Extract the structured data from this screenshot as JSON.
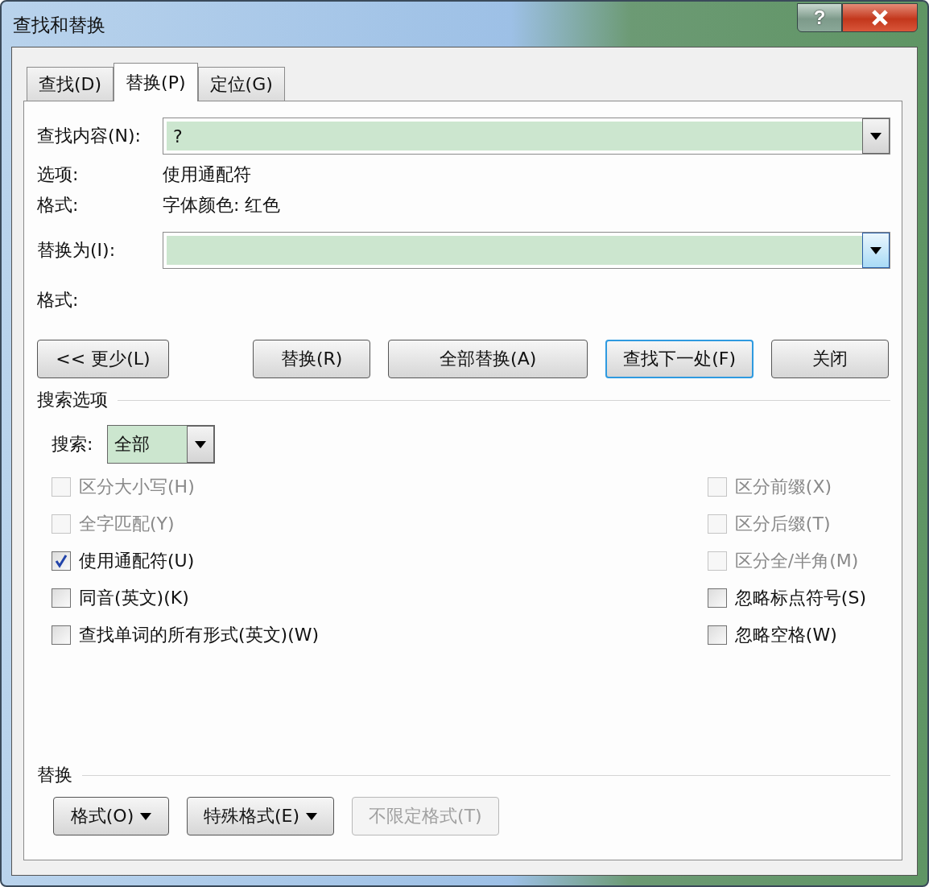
{
  "window": {
    "title": "查找和替换",
    "help": "?"
  },
  "tabs": [
    {
      "label": "查找(D)",
      "selected": false
    },
    {
      "label": "替换(P)",
      "selected": true
    },
    {
      "label": "定位(G)",
      "selected": false
    }
  ],
  "find": {
    "label": "查找内容(N):",
    "value": "?",
    "focused": false
  },
  "options": {
    "label": "选项:",
    "value": "使用通配符"
  },
  "format": {
    "label": "格式:",
    "value": "字体颜色: 红色"
  },
  "replace": {
    "label": "替换为(I):",
    "focused": true
  },
  "replace_format": {
    "label": "格式:"
  },
  "buttons": [
    {
      "label": "<< 更少(L)",
      "default": false
    },
    {
      "label": "替换(R)",
      "default": false
    },
    {
      "label": "全部替换(A)",
      "default": false
    },
    {
      "label": "查找下一处(F)",
      "default": true
    },
    {
      "label": "关闭",
      "default": false
    }
  ],
  "search_options": {
    "title": "搜索选项",
    "search_label": "搜索:",
    "search_value": "全部",
    "left": [
      {
        "label": "区分大小写(H)",
        "checked": false,
        "disabled": true
      },
      {
        "label": "全字匹配(Y)",
        "checked": false,
        "disabled": true
      },
      {
        "label": "使用通配符(U)",
        "checked": true,
        "disabled": false
      },
      {
        "label": "同音(英文)(K)",
        "checked": false,
        "disabled": false
      },
      {
        "label": "查找单词的所有形式(英文)(W)",
        "checked": false,
        "disabled": false
      }
    ],
    "right": [
      {
        "label": "区分前缀(X)",
        "checked": false,
        "disabled": true
      },
      {
        "label": "区分后缀(T)",
        "checked": false,
        "disabled": true
      },
      {
        "label": "区分全/半角(M)",
        "checked": false,
        "disabled": true
      },
      {
        "label": "忽略标点符号(S)",
        "checked": false,
        "disabled": false
      },
      {
        "label": "忽略空格(W)",
        "checked": false,
        "disabled": false
      }
    ]
  },
  "replace_section": {
    "title": "替换",
    "buttons": [
      {
        "label": "格式(O)",
        "dropdown": true,
        "disabled": false
      },
      {
        "label": "特殊格式(E)",
        "dropdown": true,
        "disabled": false
      },
      {
        "label": "不限定格式(T)",
        "dropdown": false,
        "disabled": true
      }
    ]
  }
}
